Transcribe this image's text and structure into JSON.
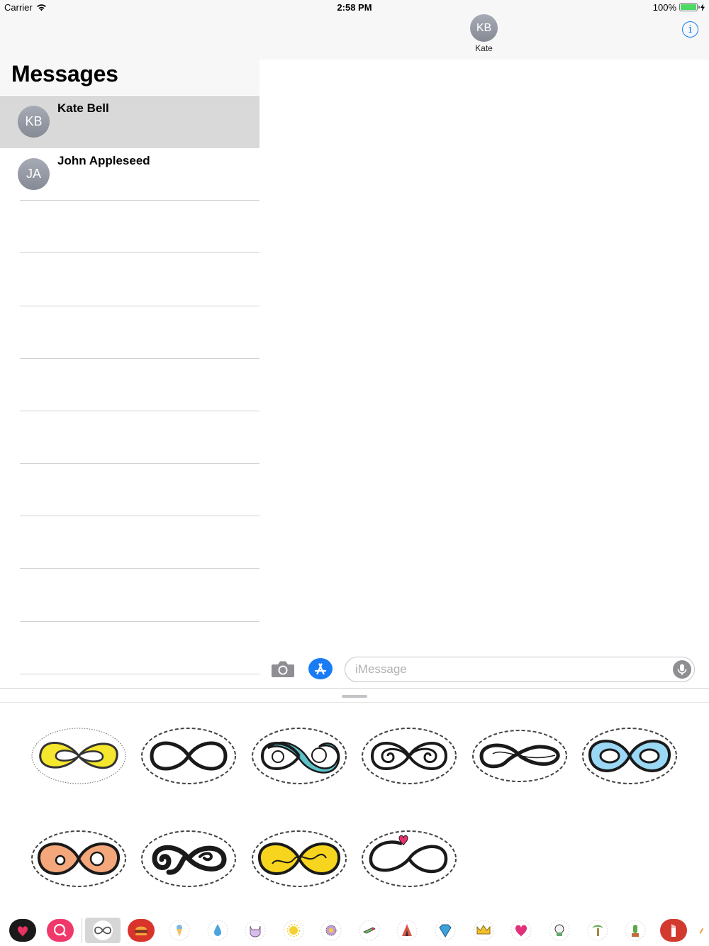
{
  "status_bar": {
    "carrier": "Carrier",
    "time": "2:58 PM",
    "battery": "100%",
    "battery_level": 1.0
  },
  "sidebar": {
    "title": "Messages",
    "conversations": [
      {
        "initials": "KB",
        "name": "Kate Bell",
        "selected": true
      },
      {
        "initials": "JA",
        "name": "John Appleseed",
        "selected": false
      }
    ]
  },
  "conversation": {
    "header": {
      "initials": "KB",
      "name": "Kate",
      "info_icon": "info-icon"
    },
    "input": {
      "placeholder": "iMessage",
      "value": ""
    },
    "icons": {
      "camera": "camera-icon",
      "app_store": "app-store-icon",
      "mic": "microphone-icon"
    }
  },
  "sticker_drawer": {
    "stickers": [
      {
        "name": "infinity-yellow",
        "fill": "#f5e62e"
      },
      {
        "name": "infinity-black-outline",
        "fill": "#ffffff"
      },
      {
        "name": "infinity-teal-swirl",
        "fill": "#5cc1c8"
      },
      {
        "name": "infinity-double-swirl",
        "fill": "#ffffff"
      },
      {
        "name": "infinity-thin-stroke",
        "fill": "#ffffff"
      },
      {
        "name": "infinity-light-blue",
        "fill": "#9ad8f5"
      },
      {
        "name": "infinity-peach",
        "fill": "#f5a77c"
      },
      {
        "name": "infinity-black-curl",
        "fill": "#ffffff"
      },
      {
        "name": "infinity-yellow-squiggle",
        "fill": "#f7d51e"
      },
      {
        "name": "infinity-heart",
        "fill": "#ffffff"
      }
    ]
  },
  "app_strip": {
    "apps": [
      {
        "name": "heart-sticker-app-icon",
        "color": "#e8325f"
      },
      {
        "name": "search-sticker-app-icon",
        "color": "#f0386b"
      },
      {
        "name": "infinity-app-icon",
        "color": "#555555",
        "selected": true
      },
      {
        "name": "burger-app-icon",
        "color": "#d9342b"
      },
      {
        "name": "ice-cream-app-icon",
        "color": "#7fb6e8"
      },
      {
        "name": "water-drop-app-icon",
        "color": "#4aa3df"
      },
      {
        "name": "cat-app-icon",
        "color": "#b07fc7"
      },
      {
        "name": "sun-app-icon",
        "color": "#f6d02e"
      },
      {
        "name": "flower-app-icon",
        "color": "#c79ad9"
      },
      {
        "name": "rocket-app-icon",
        "color": "#6dbf5e"
      },
      {
        "name": "tent-app-icon",
        "color": "#d8574a"
      },
      {
        "name": "diamond-app-icon",
        "color": "#3ea1d8"
      },
      {
        "name": "crown-app-icon",
        "color": "#f2c12e"
      },
      {
        "name": "heart-app-icon",
        "color": "#e0317a"
      },
      {
        "name": "skull-app-icon",
        "color": "#67a86a"
      },
      {
        "name": "palm-tree-app-icon",
        "color": "#a8864b"
      },
      {
        "name": "cactus-app-icon",
        "color": "#5aa84a"
      },
      {
        "name": "lipstick-app-icon",
        "color": "#d33a2f"
      },
      {
        "name": "pencil-app-icon",
        "color": "#f28c2a"
      }
    ]
  }
}
